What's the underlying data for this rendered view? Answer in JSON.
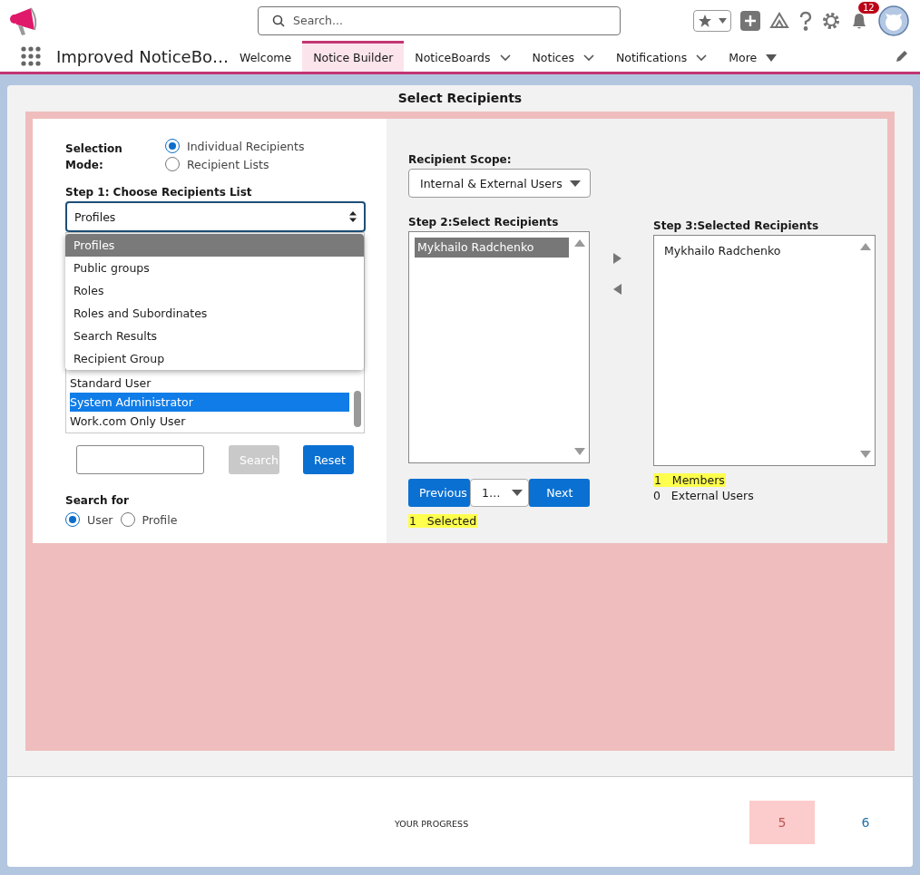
{
  "header": {
    "search_placeholder": "Search...",
    "notification_count": "12"
  },
  "app": {
    "title": "Improved NoticeBo…"
  },
  "nav_tabs": [
    {
      "label": "Welcome",
      "selected": false,
      "kind": "plain"
    },
    {
      "label": "Notice Builder",
      "selected": true,
      "kind": "plain"
    },
    {
      "label": "NoticeBoards",
      "selected": false,
      "kind": "chevron"
    },
    {
      "label": "Notices",
      "selected": false,
      "kind": "chevron"
    },
    {
      "label": "Notifications",
      "selected": false,
      "kind": "chevron"
    },
    {
      "label": "More",
      "selected": false,
      "kind": "triangle"
    }
  ],
  "page_title": "Select Recipients",
  "selection_mode": {
    "label": "Selection Mode:",
    "options": [
      {
        "label": "Individual Recipients",
        "selected": true
      },
      {
        "label": "Recipient Lists",
        "selected": false
      }
    ]
  },
  "step1": {
    "label": "Step 1: Choose Recipients List",
    "select": {
      "value": "Profiles",
      "expanded": true,
      "options": [
        {
          "label": "Profiles",
          "selected": true
        },
        {
          "label": "Public groups",
          "selected": false
        },
        {
          "label": "Roles",
          "selected": false
        },
        {
          "label": "Roles and Subordinates",
          "selected": false
        },
        {
          "label": "Search Results",
          "selected": false
        },
        {
          "label": "Recipient Group",
          "selected": false
        }
      ]
    },
    "list_items": [
      {
        "label": "Standard User",
        "selected": false
      },
      {
        "label": "System Administrator",
        "selected": true
      },
      {
        "label": "Work.com Only User",
        "selected": false
      }
    ]
  },
  "search": {
    "search_button": "Search",
    "search_disabled": true,
    "reset_button": "Reset"
  },
  "search_for": {
    "label": "Search for",
    "options": [
      {
        "label": "User",
        "selected": true
      },
      {
        "label": "Profile",
        "selected": false
      }
    ]
  },
  "scope": {
    "label": "Recipient Scope:",
    "value": "Internal & External Users"
  },
  "step2": {
    "label": "Step 2:Select Recipients",
    "items": [
      {
        "label": "Mykhailo Radchenko",
        "selected": true
      }
    ],
    "previous": "Previous",
    "page": "1…",
    "next": "Next",
    "count": "1",
    "count_label": "Selected"
  },
  "step3": {
    "label": "Step 3:Selected Recipients",
    "items": [
      {
        "label": "Mykhailo Radchenko",
        "selected": false
      }
    ],
    "members": {
      "count": "1",
      "label": "Members"
    },
    "external": {
      "count": "0",
      "label": "External Users"
    }
  },
  "progress": {
    "label": "YOUR PROGRESS",
    "steps": [
      {
        "label": "5",
        "selected": true
      },
      {
        "label": "6",
        "selected": false
      }
    ]
  }
}
